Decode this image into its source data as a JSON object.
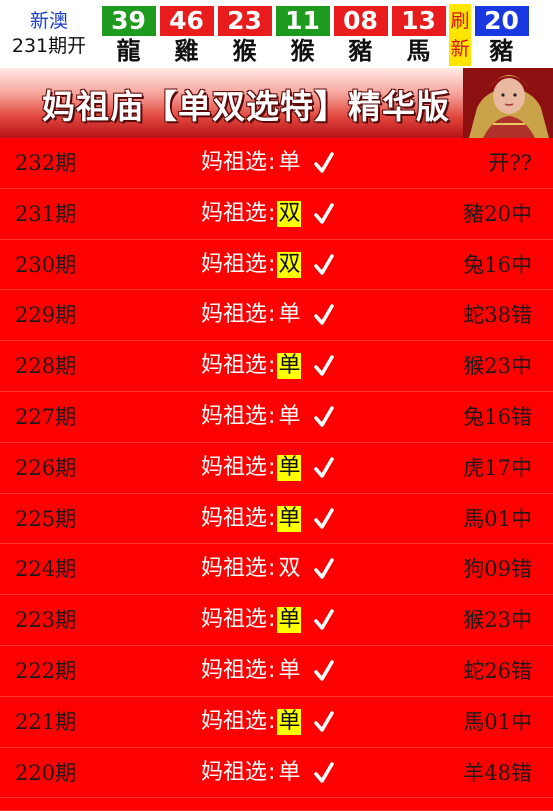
{
  "header": {
    "brand_name": "新澳",
    "issue_label": "231期开",
    "balls": [
      {
        "number": "39",
        "zodiac": "龍",
        "color": "#1e9a1e"
      },
      {
        "number": "46",
        "zodiac": "雞",
        "color": "#e81c1c"
      },
      {
        "number": "23",
        "zodiac": "猴",
        "color": "#e81c1c"
      },
      {
        "number": "11",
        "zodiac": "猴",
        "color": "#1e9a1e"
      },
      {
        "number": "08",
        "zodiac": "豬",
        "color": "#e81c1c"
      },
      {
        "number": "13",
        "zodiac": "馬",
        "color": "#e81c1c"
      }
    ],
    "refresh_top": "刷",
    "refresh_bottom": "新",
    "special": {
      "number": "20",
      "zodiac": "豬",
      "color": "#1a38e0"
    }
  },
  "banner": {
    "title": "妈祖庙【单双选特】精华版"
  },
  "rows": [
    {
      "period": "232期",
      "label": "妈祖选",
      "value": "单",
      "highlight": false,
      "result": "开??"
    },
    {
      "period": "231期",
      "label": "妈祖选",
      "value": "双",
      "highlight": true,
      "result": "豬20中"
    },
    {
      "period": "230期",
      "label": "妈祖选",
      "value": "双",
      "highlight": true,
      "result": "兔16中"
    },
    {
      "period": "229期",
      "label": "妈祖选",
      "value": "单",
      "highlight": false,
      "result": "蛇38错"
    },
    {
      "period": "228期",
      "label": "妈祖选",
      "value": "单",
      "highlight": true,
      "result": "猴23中"
    },
    {
      "period": "227期",
      "label": "妈祖选",
      "value": "单",
      "highlight": false,
      "result": "兔16错"
    },
    {
      "period": "226期",
      "label": "妈祖选",
      "value": "单",
      "highlight": true,
      "result": "虎17中"
    },
    {
      "period": "225期",
      "label": "妈祖选",
      "value": "单",
      "highlight": true,
      "result": "馬01中"
    },
    {
      "period": "224期",
      "label": "妈祖选",
      "value": "双",
      "highlight": false,
      "result": "狗09错"
    },
    {
      "period": "223期",
      "label": "妈祖选",
      "value": "单",
      "highlight": true,
      "result": "猴23中"
    },
    {
      "period": "222期",
      "label": "妈祖选",
      "value": "单",
      "highlight": false,
      "result": "蛇26错"
    },
    {
      "period": "221期",
      "label": "妈祖选",
      "value": "单",
      "highlight": true,
      "result": "馬01中"
    },
    {
      "period": "220期",
      "label": "妈祖选",
      "value": "单",
      "highlight": false,
      "result": "羊48错"
    }
  ]
}
